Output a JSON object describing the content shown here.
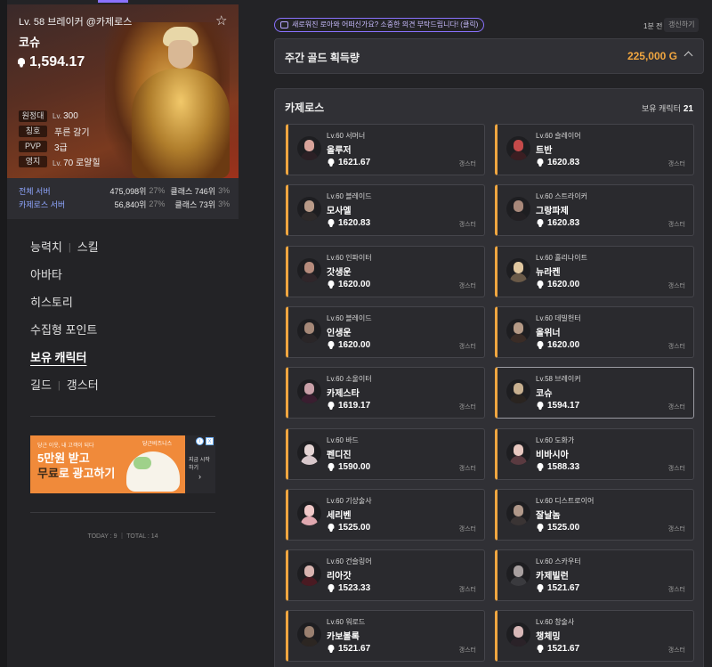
{
  "profile": {
    "header": "Lv. 58 브레이커 @카제로스",
    "name": "코슈",
    "item_level": "1,594.17",
    "rows": [
      {
        "label": "원정대",
        "prefix": "Lv.",
        "value": "300"
      },
      {
        "label": "칭호",
        "prefix": "",
        "value": "푸른 갈기"
      },
      {
        "label": "PVP",
        "prefix": "",
        "value": "3급"
      },
      {
        "label": "영지",
        "prefix": "Lv.",
        "value": "70 로얄힐"
      }
    ]
  },
  "ranking": [
    {
      "label": "전체 서버",
      "rank": "475,098위",
      "pct": "27%",
      "class_rank": "클래스 746위",
      "class_pct": "3%"
    },
    {
      "label": "카제로스 서버",
      "rank": "56,840위",
      "pct": "27%",
      "class_rank": "클래스 73위",
      "class_pct": "3%"
    }
  ],
  "menu": {
    "stats": "능력치",
    "skills": "스킬",
    "avatar": "아바타",
    "history": "히스토리",
    "collectibles": "수집형 포인트",
    "characters": "보유 캐릭터",
    "guild": "길드",
    "gangster": "갱스터"
  },
  "ad": {
    "tiny_text": "당근 이웃, 내 고객이 되다",
    "brand": "당근비즈니스",
    "line1": "5만원 받고",
    "line2_highlight": "무료",
    "line2_rest": "로 광고하기",
    "cta": "지금 시작하기",
    "chevron": "›",
    "info": "i",
    "close": "x"
  },
  "visit": "TODAY : 9 ｜ TOTAL : 14",
  "topbar": {
    "feedback": "새로워진 로아와 어떠신가요? 소중한 의견 부탁드립니다! (클릭)",
    "time": "1분 전",
    "refresh": "갱신하기"
  },
  "gold": {
    "title": "주간 골드 획득량",
    "amount": "225,000 G"
  },
  "server": {
    "name": "카제로스",
    "owned_label": "보유 캐릭터",
    "owned_count": "21"
  },
  "characters": [
    {
      "cls": "Lv.60 서머너",
      "name": "올루저",
      "ilvl": "1621.67",
      "tag": "갱스터",
      "skin": "#d8a39a",
      "cloth": "#2b2025"
    },
    {
      "cls": "Lv.60 슬레이어",
      "name": "트반",
      "ilvl": "1620.83",
      "tag": "갱스터",
      "skin": "#c44a4a",
      "cloth": "#3a1e22"
    },
    {
      "cls": "Lv.60 블레이드",
      "name": "모사엘",
      "ilvl": "1620.83",
      "tag": "갱스터",
      "skin": "#b89a88",
      "cloth": "#2e2a2a"
    },
    {
      "cls": "Lv.60 스트라이커",
      "name": "그랑파제",
      "ilvl": "1620.83",
      "tag": "갱스터",
      "skin": "#a8887a",
      "cloth": "#242124"
    },
    {
      "cls": "Lv.60 인파이터",
      "name": "갓생운",
      "ilvl": "1620.00",
      "tag": "갱스터",
      "skin": "#b68b7c",
      "cloth": "#30262a"
    },
    {
      "cls": "Lv.60 홀리나이트",
      "name": "뉴라켄",
      "ilvl": "1620.00",
      "tag": "갱스터",
      "skin": "#e0c7a0",
      "cloth": "#6a5a48"
    },
    {
      "cls": "Lv.60 블레이드",
      "name": "인생운",
      "ilvl": "1620.00",
      "tag": "갱스터",
      "skin": "#a58878",
      "cloth": "#2a2628"
    },
    {
      "cls": "Lv.60 데빌헌터",
      "name": "올위너",
      "ilvl": "1620.00",
      "tag": "갱스터",
      "skin": "#b59a86",
      "cloth": "#3a2c26"
    },
    {
      "cls": "Lv.60 소울이터",
      "name": "카제스타",
      "ilvl": "1619.17",
      "tag": "갱스터",
      "skin": "#c9a0a8",
      "cloth": "#3a1e30"
    },
    {
      "cls": "Lv.58 브레이커",
      "name": "코슈",
      "ilvl": "1594.17",
      "tag": "갱스터",
      "skin": "#c8b090",
      "cloth": "#2a2420",
      "current": true
    },
    {
      "cls": "Lv.60 바드",
      "name": "펜디진",
      "ilvl": "1590.00",
      "tag": "갱스터",
      "skin": "#e4d4d4",
      "cloth": "#d8c8cc"
    },
    {
      "cls": "Lv.60 도화가",
      "name": "비바시아",
      "ilvl": "1588.33",
      "tag": "갱스터",
      "skin": "#e8c8c0",
      "cloth": "#5a3a40"
    },
    {
      "cls": "Lv.60 기상술사",
      "name": "세리벤",
      "ilvl": "1525.00",
      "tag": "갱스터",
      "skin": "#f0c8c8",
      "cloth": "#e0a8b0"
    },
    {
      "cls": "Lv.60 디스트로이어",
      "name": "잘날놈",
      "ilvl": "1525.00",
      "tag": "갱스터",
      "skin": "#b0988a",
      "cloth": "#3a3434"
    },
    {
      "cls": "Lv.60 건슬링어",
      "name": "리아갓",
      "ilvl": "1523.33",
      "tag": "갱스터",
      "skin": "#d8b4b0",
      "cloth": "#4a1a22"
    },
    {
      "cls": "Lv.60 스카우터",
      "name": "카제빌런",
      "ilvl": "1521.67",
      "tag": "갱스터",
      "skin": "#a8a0a0",
      "cloth": "#3a3a3e"
    },
    {
      "cls": "Lv.60 워로드",
      "name": "카보볼록",
      "ilvl": "1521.67",
      "tag": "갱스터",
      "skin": "#9a8070",
      "cloth": "#2c2622"
    },
    {
      "cls": "Lv.60 창술사",
      "name": "챙체밍",
      "ilvl": "1521.67",
      "tag": "갱스터",
      "skin": "#d8b8b8",
      "cloth": "#2a2228"
    }
  ]
}
